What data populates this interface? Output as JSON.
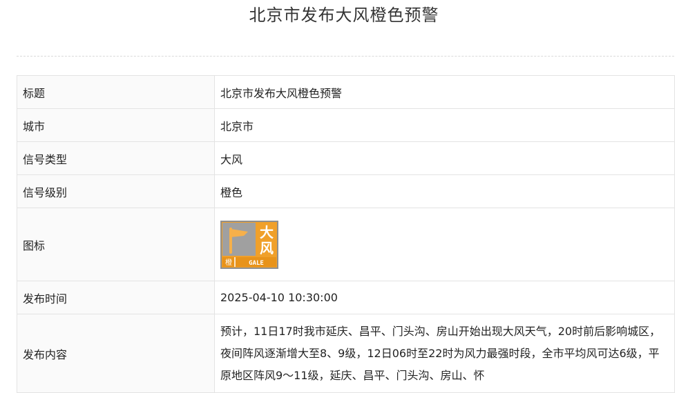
{
  "page": {
    "title": "北京市发布大风橙色预警"
  },
  "table": {
    "rows": [
      {
        "label": "标题",
        "value": "北京市发布大风橙色预警"
      },
      {
        "label": "城市",
        "value": "北京市"
      },
      {
        "label": "信号类型",
        "value": "大风"
      },
      {
        "label": "信号级别",
        "value": "橙色"
      },
      {
        "label": "图标"
      },
      {
        "label": "发布时间",
        "value": "2025-04-10 10:30:00"
      },
      {
        "label": "发布内容",
        "value": "预计，11日17时我市延庆、昌平、门头沟、房山开始出现大风天气，20时前后影响城区，夜间阵风逐渐增大至8、9级，12日06时至22时为风力最强时段，全市平均风可达6级，平原地区阵风9～11级，延庆、昌平、门头沟、房山、怀"
      }
    ]
  },
  "icon": {
    "name": "gale-orange-warning-icon",
    "char_main": "大",
    "char_sub": "风",
    "level_char": "橙",
    "english": "GALE",
    "colors": {
      "orange": "#f0a02a",
      "gray": "#9a9a9a",
      "white": "#ffffff"
    }
  }
}
